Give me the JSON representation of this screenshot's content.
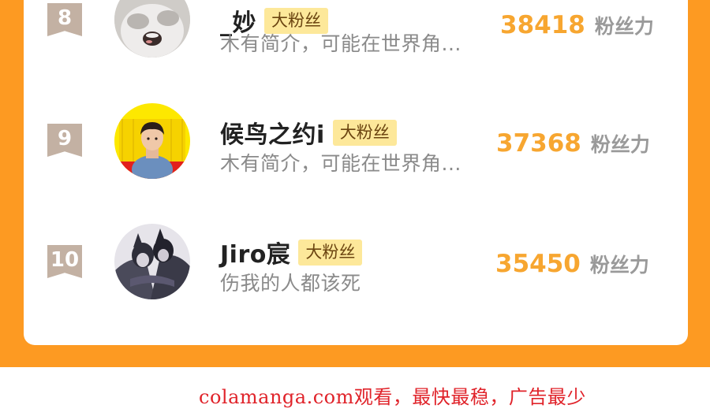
{
  "ranking": {
    "rows": [
      {
        "rank": "8",
        "name": "_妙",
        "tag": "大粉丝",
        "bio": "木有简介，可能在世界角...",
        "score": "38418",
        "score_unit": "粉丝力",
        "avatar_icon": "cat-avatar-icon"
      },
      {
        "rank": "9",
        "name": "候鸟之约i",
        "tag": "大粉丝",
        "bio": "木有简介，可能在世界角...",
        "score": "37368",
        "score_unit": "粉丝力",
        "avatar_icon": "boy-photo-avatar-icon"
      },
      {
        "rank": "10",
        "name": "Jiro宸",
        "tag": "大粉丝",
        "bio": "伤我的人都该死",
        "score": "35450",
        "score_unit": "粉丝力",
        "avatar_icon": "illustration-avatar-icon"
      }
    ]
  },
  "footer": {
    "watermark": "colamanga.com观看，最快最稳，广告最少"
  },
  "colors": {
    "background_orange": "#fd9a22",
    "score": "#f7a630",
    "tag_bg": "#fde89a",
    "rank_badge": "#c3b1a3",
    "watermark": "#e0232a"
  }
}
